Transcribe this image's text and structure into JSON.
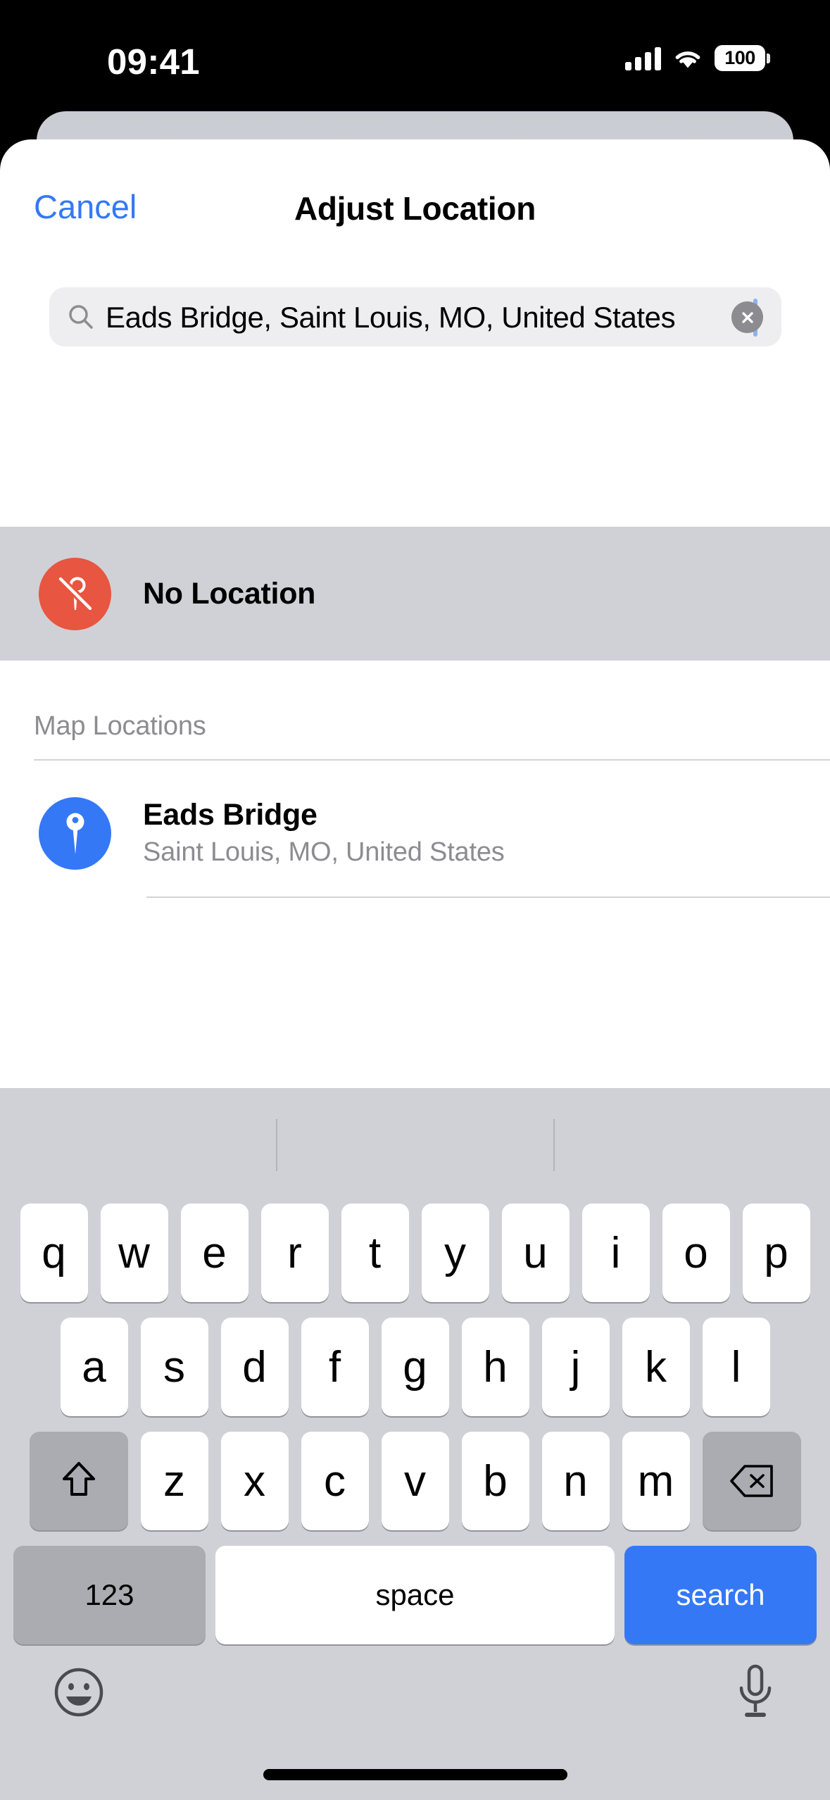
{
  "status_bar": {
    "time": "09:41",
    "battery_level": "100",
    "signal_icon": "cellular-signal-icon",
    "wifi_icon": "wifi-icon",
    "battery_icon": "battery-icon"
  },
  "navbar": {
    "cancel_label": "Cancel",
    "title": "Adjust Location"
  },
  "search": {
    "value": "Eads Bridge, Saint Louis, MO, United States",
    "placeholder": "Search",
    "search_icon": "magnifying-glass-icon",
    "clear_icon": "clear-circle-icon"
  },
  "no_location": {
    "label": "No Location",
    "icon": "no-location-slash-pin-icon",
    "icon_color": "#e85541"
  },
  "map_locations": {
    "section_title": "Map Locations",
    "results": [
      {
        "title": "Eads Bridge",
        "subtitle": "Saint Louis, MO, United States",
        "icon": "map-pin-icon",
        "icon_color": "#3478f6"
      }
    ]
  },
  "keyboard": {
    "row1": [
      "q",
      "w",
      "e",
      "r",
      "t",
      "y",
      "u",
      "i",
      "o",
      "p"
    ],
    "row2": [
      "a",
      "s",
      "d",
      "f",
      "g",
      "h",
      "j",
      "k",
      "l"
    ],
    "row3": [
      "z",
      "x",
      "c",
      "v",
      "b",
      "n",
      "m"
    ],
    "shift_icon": "shift-arrow-icon",
    "backspace_icon": "backspace-delete-icon",
    "numbers_label": "123",
    "space_label": "space",
    "return_label": "search",
    "emoji_icon": "emoji-smiley-icon",
    "dictation_icon": "microphone-icon"
  },
  "colors": {
    "accent_blue": "#3478f6",
    "keyboard_bg": "#d0d1d6",
    "highlight_row": "#d0d1d6",
    "search_field_bg": "#eeeef0",
    "secondary_text": "#8c8c91"
  }
}
